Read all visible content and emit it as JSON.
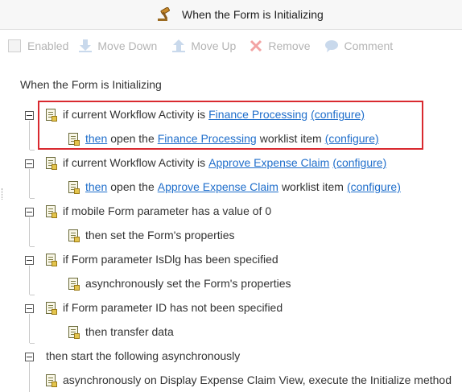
{
  "header": {
    "title": "When the Form is Initializing",
    "icon": "gavel-icon"
  },
  "toolbar": {
    "enabled": "Enabled",
    "move_down": "Move Down",
    "move_up": "Move Up",
    "remove": "Remove",
    "comment": "Comment"
  },
  "root": {
    "label": "When the Form is Initializing"
  },
  "rules": [
    {
      "cond": {
        "pre": "if current Workflow Activity is",
        "link": "Finance Processing",
        "cfg": "(configure)"
      },
      "action": {
        "then": "then",
        "mid": "open the",
        "link": "Finance Processing",
        "post": "worklist item",
        "cfg": "(configure)"
      }
    },
    {
      "cond": {
        "pre": "if current Workflow Activity is",
        "link": "Approve Expense Claim",
        "cfg": "(configure)"
      },
      "action": {
        "then": "then",
        "mid": "open the",
        "link": "Approve Expense Claim",
        "post": "worklist item",
        "cfg": "(configure)"
      }
    },
    {
      "cond": {
        "text": "if mobile Form parameter has a value of 0"
      },
      "action": {
        "text": "then set the Form's properties"
      }
    },
    {
      "cond": {
        "text": "if Form parameter IsDlg has been specified"
      },
      "action": {
        "text": "asynchronously set the Form's properties"
      }
    },
    {
      "cond": {
        "text": "if Form parameter ID has not been specified"
      },
      "action": {
        "text": "then transfer data"
      }
    },
    {
      "cond": {
        "text": "then start the following asynchronously"
      },
      "action": {
        "text": "asynchronously on Display Expense Claim View, execute the Initialize method"
      }
    }
  ],
  "colors": {
    "link": "#1f6ecb",
    "highlight": "#d9292f",
    "disabled": "#b4b4b4"
  }
}
